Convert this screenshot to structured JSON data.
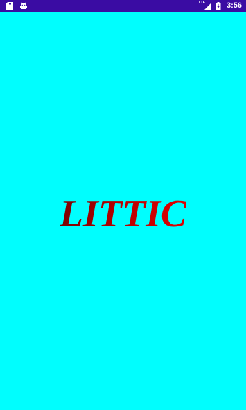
{
  "status_bar": {
    "left_icons": [
      "sd-card-icon",
      "android-icon"
    ],
    "network_label": "LTE",
    "time": "3:56",
    "right_icons": [
      "signal-icon",
      "battery-charging-icon"
    ]
  },
  "splash": {
    "brand_text": "LITTIC"
  },
  "colors": {
    "status_bar_background": "#3A0CA3",
    "screen_background": "#00FEFE",
    "brand_text": "#B30000"
  }
}
